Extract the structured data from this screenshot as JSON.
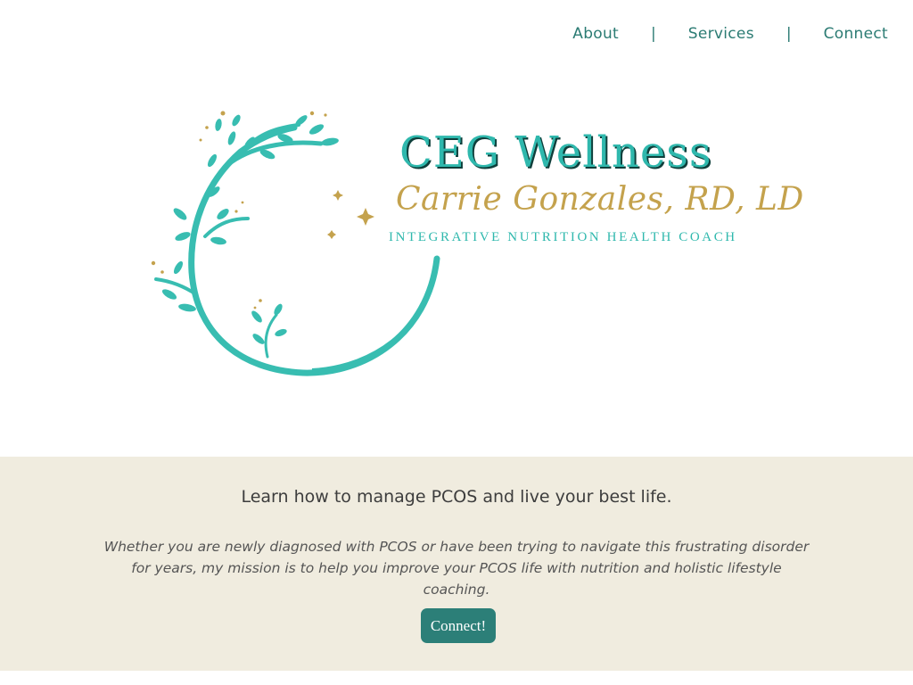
{
  "nav": {
    "items": [
      {
        "label": "About"
      },
      {
        "label": "Services"
      },
      {
        "label": "Connect"
      }
    ],
    "separator": "|"
  },
  "logo": {
    "title": "CEG Wellness",
    "script_name": "Carrie Gonzales, RD, LD",
    "subtitle": "INTEGRATIVE NUTRITION HEALTH COACH",
    "colors": {
      "teal": "#2fb8ad",
      "gold": "#c4a24d",
      "shadow": "#0f3f3b"
    }
  },
  "intro": {
    "heading": "Learn how to manage PCOS and live your best life.",
    "body": "Whether you are newly diagnosed with PCOS or have been trying to navigate this frustrating disorder for years, my mission is to help you improve your PCOS life with nutrition and holistic lifestyle coaching.",
    "button_label": "Connect!",
    "band_color": "#f0ecdf",
    "button_color": "#2c7f78"
  }
}
